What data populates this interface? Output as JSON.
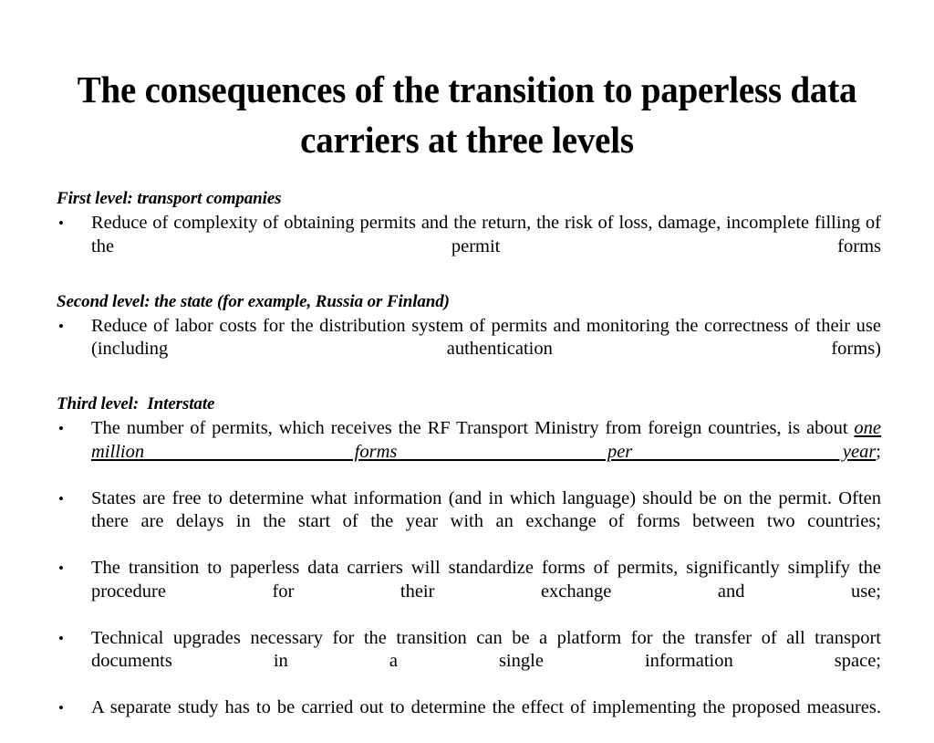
{
  "slide": {
    "title": "The consequences of the transition to paperless data carriers at three levels",
    "sections": [
      {
        "heading": "First level: transport companies",
        "bullets": [
          {
            "marker": "•",
            "text": "Reduce of complexity of obtaining permits and the return, the risk of loss, damage, incomplete filling of the permit forms"
          }
        ]
      },
      {
        "heading": "Second level: the state (for example, Russia or Finland)",
        "bullets": [
          {
            "marker": "•",
            "text": "Reduce of labor costs for the distribution system of permits and monitoring the correctness of their use (including authentication forms)"
          }
        ]
      },
      {
        "heading": "Third level:  Interstate",
        "bullets": [
          {
            "marker": "•",
            "text_before": "The number of permits, which receives the RF Transport Ministry from foreign countries, is about ",
            "emphasis": "one million forms per year",
            "text_after": ";"
          },
          {
            "marker": "•",
            "text": "States are free to determine what information (and in which language) should be on the permit. Often there are delays in the start of the year with an exchange of forms between two countries;"
          },
          {
            "marker": "•",
            "text": "The transition to paperless data carriers will standardize forms of permits, significantly simplify the procedure for their exchange and use;"
          },
          {
            "marker": "•",
            "text": "Technical upgrades necessary  for the transition can be a platform for the transfer of all transport documents in a single information space;"
          },
          {
            "marker": "•",
            "text": "A separate study has to be carried out to determine the effect of implementing the proposed measures."
          }
        ]
      }
    ]
  },
  "colors": {
    "background": "#ffffff",
    "text": "#000000"
  }
}
